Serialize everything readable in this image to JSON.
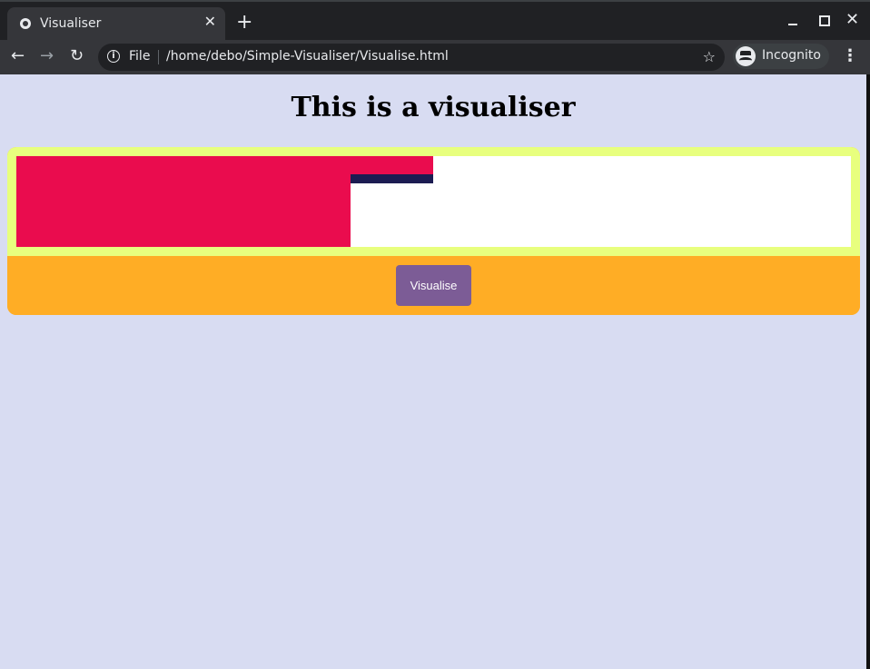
{
  "browser": {
    "tab_title": "Visualiser",
    "tab_close": "✕",
    "new_tab": "+",
    "back": "←",
    "forward": "→",
    "reload": "↻",
    "scheme_label": "File",
    "url": "/home/debo/Simple-Visualiser/Visualise.html",
    "bookmark_star": "☆",
    "incognito_label": "Incognito",
    "menu": "⋮",
    "close_window": "✕"
  },
  "page": {
    "title": "This is a visualiser",
    "button_label": "Visualise"
  },
  "colors": {
    "page_background": "#d8dcf2",
    "frame": "#e8ff7e",
    "canvas": "#ffffff",
    "bar_primary": "#ea0c4e",
    "bar_accent": "#1c1c52",
    "controls": "#ffad25",
    "button": "#7c5c96"
  }
}
